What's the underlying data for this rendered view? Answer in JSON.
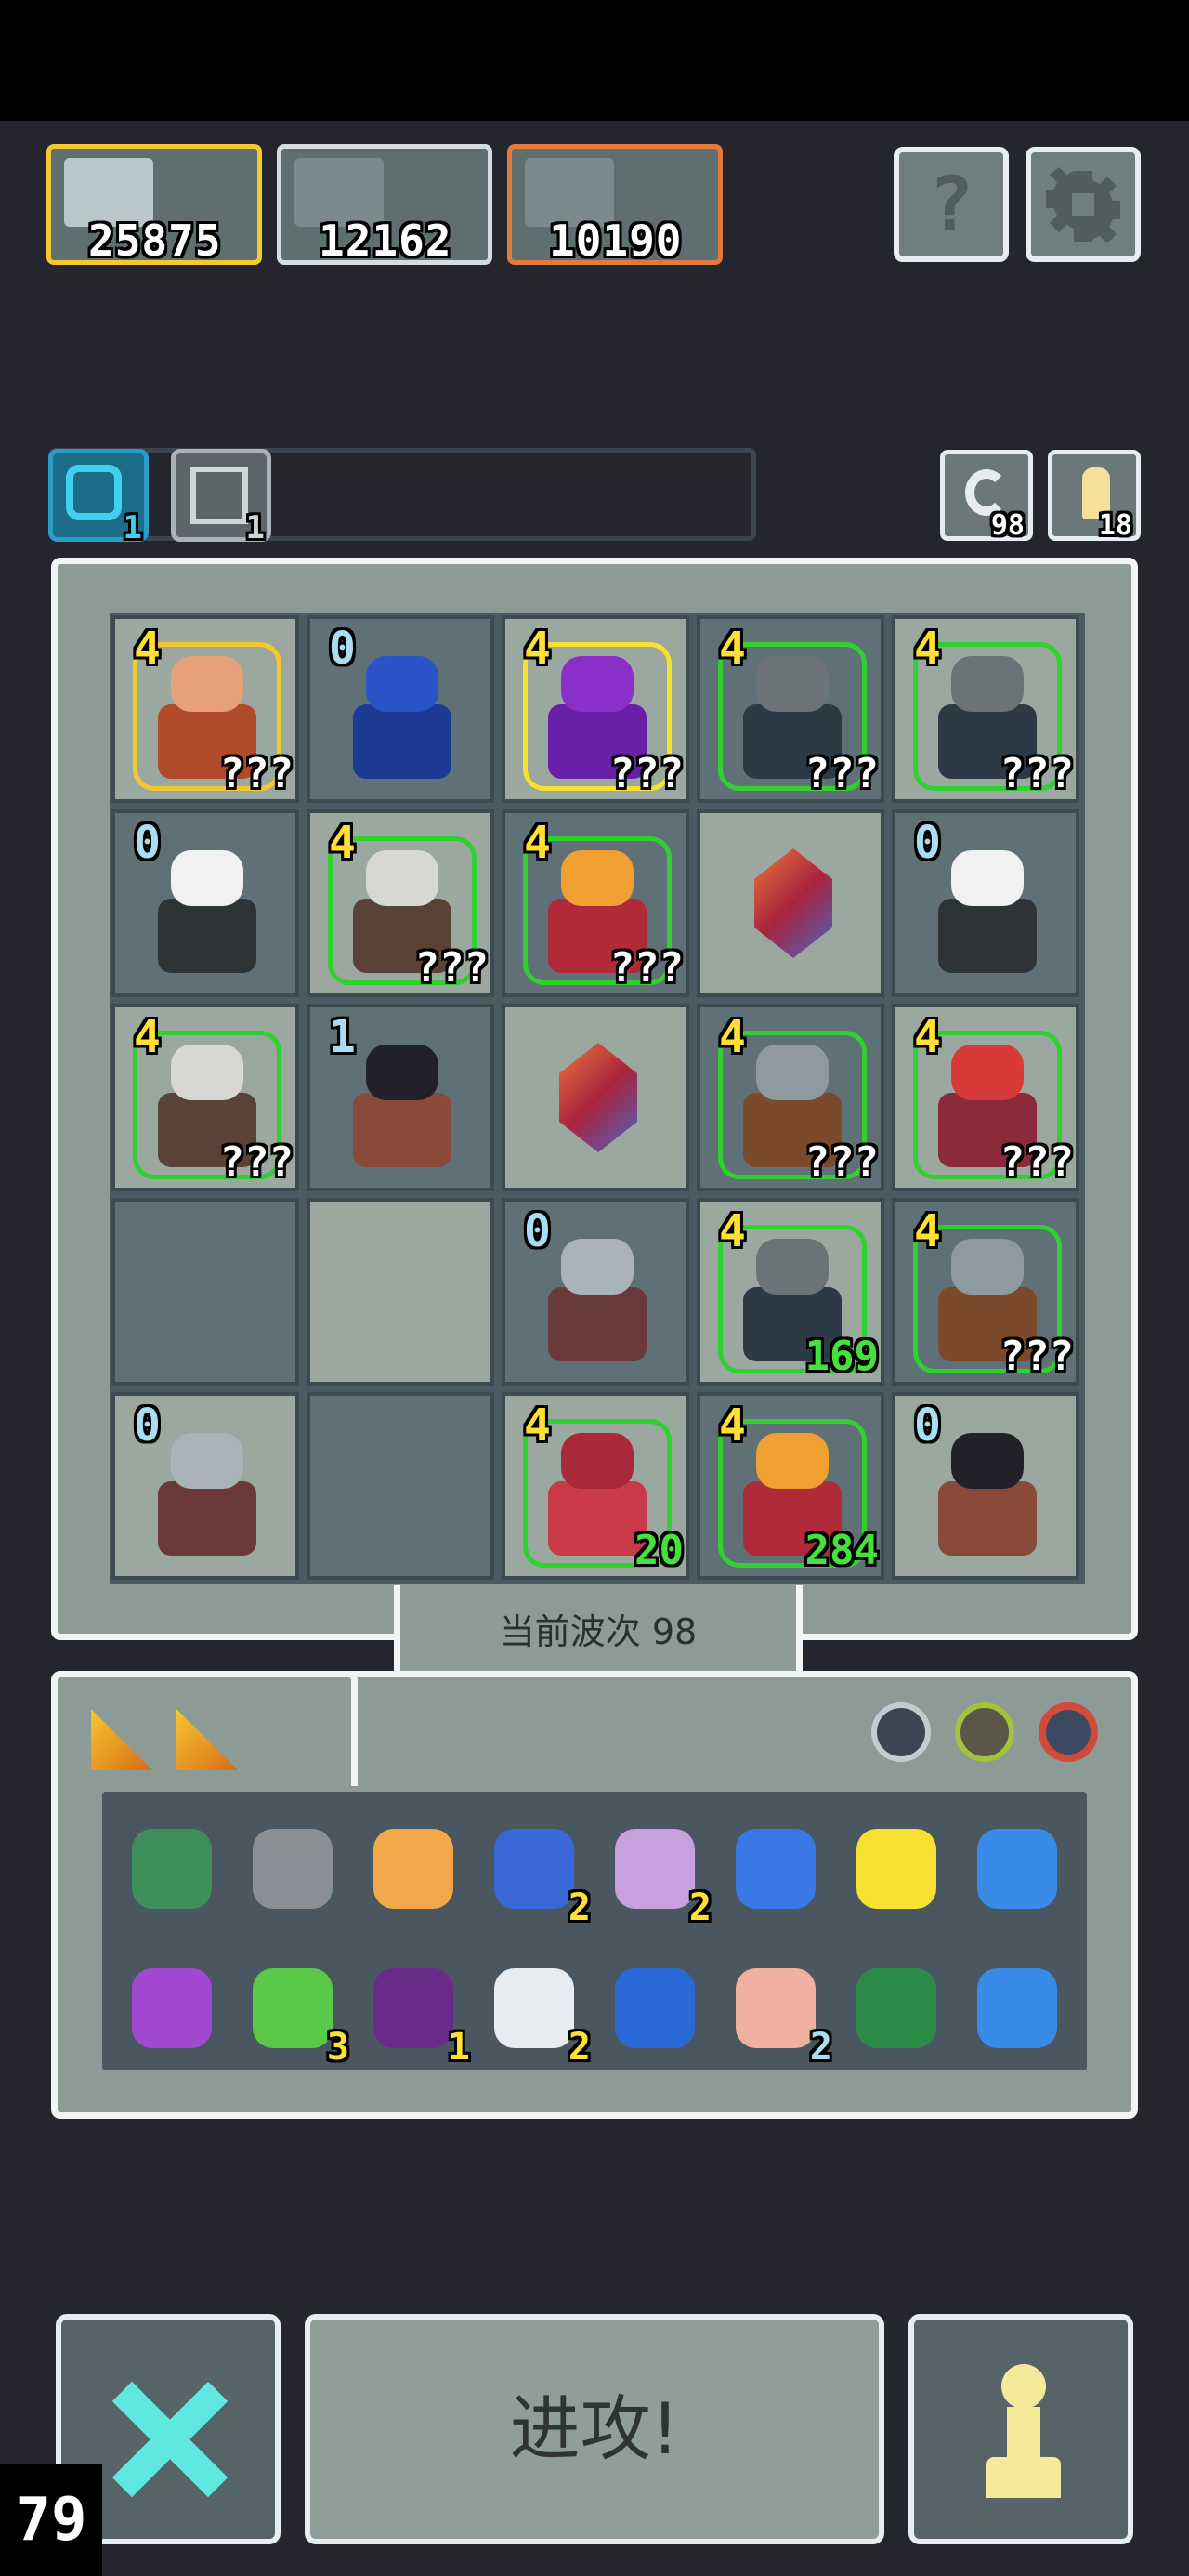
{
  "colors": {
    "gold": "#f6c830",
    "silver": "#d5dde0",
    "bronze": "#e27a3e",
    "level": "#ffe033",
    "level_zero": "#aadcf2",
    "count_green": "#44e23a"
  },
  "leaderboard": [
    {
      "score": "25875",
      "frame_color": "#f6c830"
    },
    {
      "score": "12162",
      "frame_color": "#d5dde0"
    },
    {
      "score": "10190",
      "frame_color": "#e27a3e"
    }
  ],
  "top_buttons": {
    "help_icon": "?",
    "settings_icon": "gear-icon"
  },
  "resources": {
    "swirl_count": "1",
    "sword_count": "1",
    "refresh_count": "98",
    "pawn_count": "18"
  },
  "grid": [
    [
      {
        "lvl": "4",
        "cnt": "???",
        "kind": "viking"
      },
      {
        "lvl": "0",
        "cnt": "",
        "kind": "portal"
      },
      {
        "lvl": "4",
        "cnt": "???",
        "kind": "knight"
      },
      {
        "lvl": "4",
        "cnt": "???",
        "kind": "dwarf"
      },
      {
        "lvl": "4",
        "cnt": "???",
        "kind": "dwarf"
      }
    ],
    [
      {
        "lvl": "0",
        "cnt": "",
        "kind": "witch"
      },
      {
        "lvl": "4",
        "cnt": "???",
        "kind": "elder"
      },
      {
        "lvl": "4",
        "cnt": "???",
        "kind": "king"
      },
      {
        "lvl": "",
        "cnt": "",
        "kind": "gem"
      },
      {
        "lvl": "0",
        "cnt": "",
        "kind": "witch"
      }
    ],
    [
      {
        "lvl": "4",
        "cnt": "???",
        "kind": "elder"
      },
      {
        "lvl": "1",
        "cnt": "",
        "kind": "imp"
      },
      {
        "lvl": "",
        "cnt": "",
        "kind": "gem"
      },
      {
        "lvl": "4",
        "cnt": "???",
        "kind": "shield"
      },
      {
        "lvl": "4",
        "cnt": "???",
        "kind": "warrior"
      }
    ],
    [
      {
        "lvl": "",
        "cnt": "",
        "kind": "empty"
      },
      {
        "lvl": "",
        "cnt": "",
        "kind": "empty"
      },
      {
        "lvl": "0",
        "cnt": "",
        "kind": "armor"
      },
      {
        "lvl": "4",
        "cnt": "169",
        "kind": "dwarf"
      },
      {
        "lvl": "4",
        "cnt": "???",
        "kind": "shield"
      }
    ],
    [
      {
        "lvl": "0",
        "cnt": "",
        "kind": "armor"
      },
      {
        "lvl": "",
        "cnt": "",
        "kind": "empty"
      },
      {
        "lvl": "4",
        "cnt": "20",
        "kind": "mage"
      },
      {
        "lvl": "4",
        "cnt": "284",
        "kind": "king"
      },
      {
        "lvl": "0",
        "cnt": "",
        "kind": "imp"
      }
    ]
  ],
  "wave": {
    "label": "当前波次 98"
  },
  "items": [
    [
      {
        "icon": "turtle-shell-icon",
        "q": ""
      },
      {
        "icon": "hammer-icon",
        "q": ""
      },
      {
        "icon": "ankh-icon",
        "q": ""
      },
      {
        "icon": "hourglass-icon",
        "q": "2"
      },
      {
        "icon": "potion-icon",
        "q": "2"
      },
      {
        "icon": "wind-icon",
        "q": ""
      },
      {
        "icon": "chalice-icon",
        "q": ""
      },
      {
        "icon": "lightning-icon",
        "q": ""
      }
    ],
    [
      {
        "icon": "staff-icon",
        "q": ""
      },
      {
        "icon": "herb-icon",
        "q": "3"
      },
      {
        "icon": "demon-mask-icon",
        "q": "1"
      },
      {
        "icon": "crossbow-icon",
        "q": "2"
      },
      {
        "icon": "water-orb-icon",
        "q": ""
      },
      {
        "icon": "eye-hand-icon",
        "q": "2"
      },
      {
        "icon": "rune-tablet-icon",
        "q": ""
      },
      {
        "icon": "water-drop-icon",
        "q": ""
      }
    ]
  ],
  "actions": {
    "attack_label": "进攻!"
  },
  "counter": "79"
}
